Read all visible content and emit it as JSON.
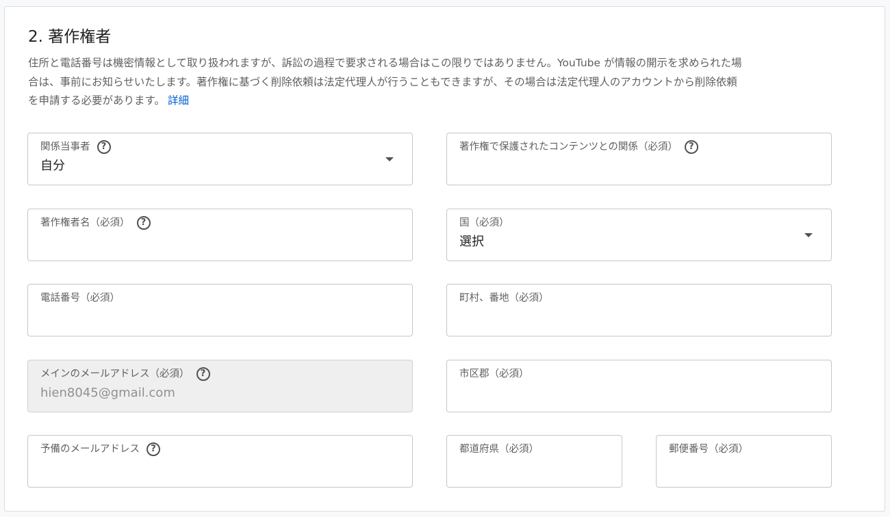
{
  "section": {
    "title": "2. 著作権者",
    "description_line1": "住所と電話番号は機密情報として取り扱われますが、訴訟の過程で要求される場合はこの限りではありません。YouTube が情報の開示を求められた場",
    "description_line2": "合は、事前にお知らせいたします。著作権に基づく削除依頼は法定代理人が行うこともできますが、その場合は法定代理人のアカウントから削除依頼",
    "description_line3": "を申請する必要があります。",
    "learn_more": "詳細"
  },
  "fields": {
    "party": {
      "label": "関係当事者",
      "value": "自分"
    },
    "relationship": {
      "label": "著作権で保護されたコンテンツとの関係（必須）",
      "value": ""
    },
    "owner_name": {
      "label": "著作権者名（必須）",
      "value": ""
    },
    "country": {
      "label": "国（必須）",
      "value": "選択"
    },
    "phone": {
      "label": "電話番号（必須）",
      "value": ""
    },
    "street": {
      "label": "町村、番地（必須）",
      "value": ""
    },
    "primary_email": {
      "label": "メインのメールアドレス（必須）",
      "value": "hien8045@gmail.com"
    },
    "city": {
      "label": "市区郡（必須）",
      "value": ""
    },
    "secondary_email": {
      "label": "予備のメールアドレス",
      "value": ""
    },
    "prefecture": {
      "label": "都道府県（必須）",
      "value": ""
    },
    "postal_code": {
      "label": "郵便番号（必須）",
      "value": ""
    }
  },
  "icons": {
    "help": "?"
  }
}
